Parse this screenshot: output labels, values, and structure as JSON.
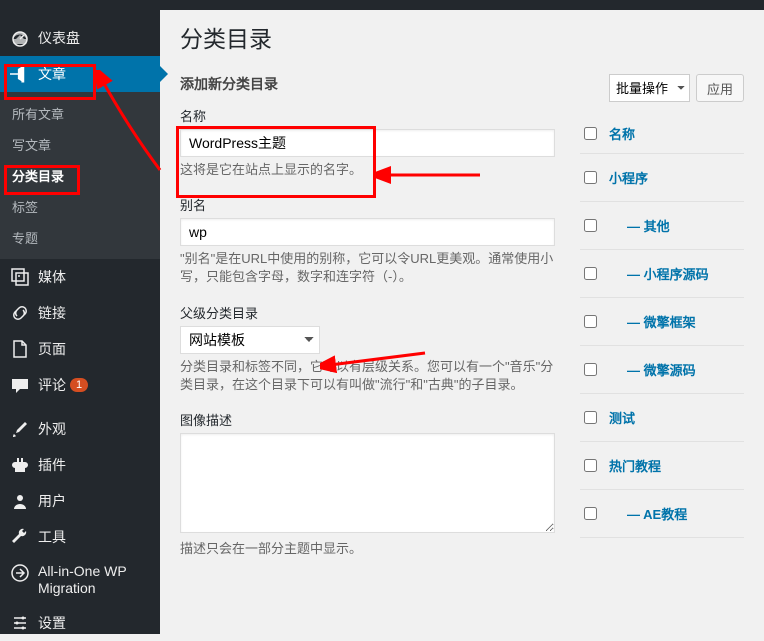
{
  "colors": {
    "accent": "#0073aa",
    "highlight": "#ff0000",
    "badge": "#d54e21"
  },
  "sidebar": {
    "dashboard": "仪表盘",
    "posts": "文章",
    "posts_sub": {
      "all": "所有文章",
      "new": "写文章",
      "categories": "分类目录",
      "tags": "标签",
      "topics": "专题"
    },
    "media": "媒体",
    "links": "链接",
    "pages": "页面",
    "comments": "评论",
    "comments_badge": "1",
    "appearance": "外观",
    "plugins": "插件",
    "users": "用户",
    "tools": "工具",
    "aio": "All-in-One WP Migration",
    "settings": "设置"
  },
  "page": {
    "title": "分类目录"
  },
  "form": {
    "section_title": "添加新分类目录",
    "name_label": "名称",
    "name_value": "WordPress主题",
    "name_desc": "这将是它在站点上显示的名字。",
    "slug_label": "别名",
    "slug_value": "wp",
    "slug_desc": "\"别名\"是在URL中使用的别称，它可以令URL更美观。通常使用小写，只能包含字母，数字和连字符（-）。",
    "parent_label": "父级分类目录",
    "parent_value": "网站模板",
    "parent_desc": "分类目录和标签不同，它可以有层级关系。您可以有一个\"音乐\"分类目录，在这个目录下可以有叫做\"流行\"和\"古典\"的子目录。",
    "desc_label": "图像描述",
    "desc_desc": "描述只会在一部分主题中显示。"
  },
  "table": {
    "bulk_label": "批量操作",
    "apply": "应用",
    "col_name": "名称",
    "rows": [
      {
        "label": "小程序",
        "indent": false
      },
      {
        "label": "— 其他",
        "indent": true
      },
      {
        "label": "— 小程序源码",
        "indent": true
      },
      {
        "label": "— 微擎框架",
        "indent": true
      },
      {
        "label": "— 微擎源码",
        "indent": true
      },
      {
        "label": "测试",
        "indent": false
      },
      {
        "label": "热门教程",
        "indent": false
      },
      {
        "label": "— AE教程",
        "indent": true
      }
    ]
  }
}
